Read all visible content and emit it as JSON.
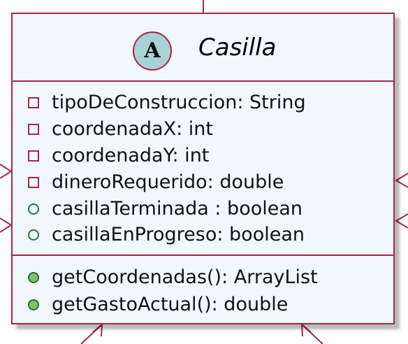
{
  "class": {
    "stereotype_letter": "A",
    "name": "Casilla"
  },
  "attributes": [
    {
      "visibility": "private",
      "text": "tipoDeConstruccion: String"
    },
    {
      "visibility": "private",
      "text": "coordenadaX: int"
    },
    {
      "visibility": "private",
      "text": "coordenadaY: int"
    },
    {
      "visibility": "private",
      "text": "dineroRequerido: double"
    },
    {
      "visibility": "public",
      "text": "casillaTerminada : boolean"
    },
    {
      "visibility": "public",
      "text": "casillaEnProgreso: boolean"
    }
  ],
  "operations": [
    {
      "visibility": "public",
      "text": "getCoordenadas(): ArrayList"
    },
    {
      "visibility": "public",
      "text": "getGastoActual(): double"
    }
  ],
  "colors": {
    "border": "#a8264a",
    "background": "#f1f7fc",
    "stereotype_circle": "#a8d2d6",
    "public_operation_marker": "#82c36a"
  }
}
